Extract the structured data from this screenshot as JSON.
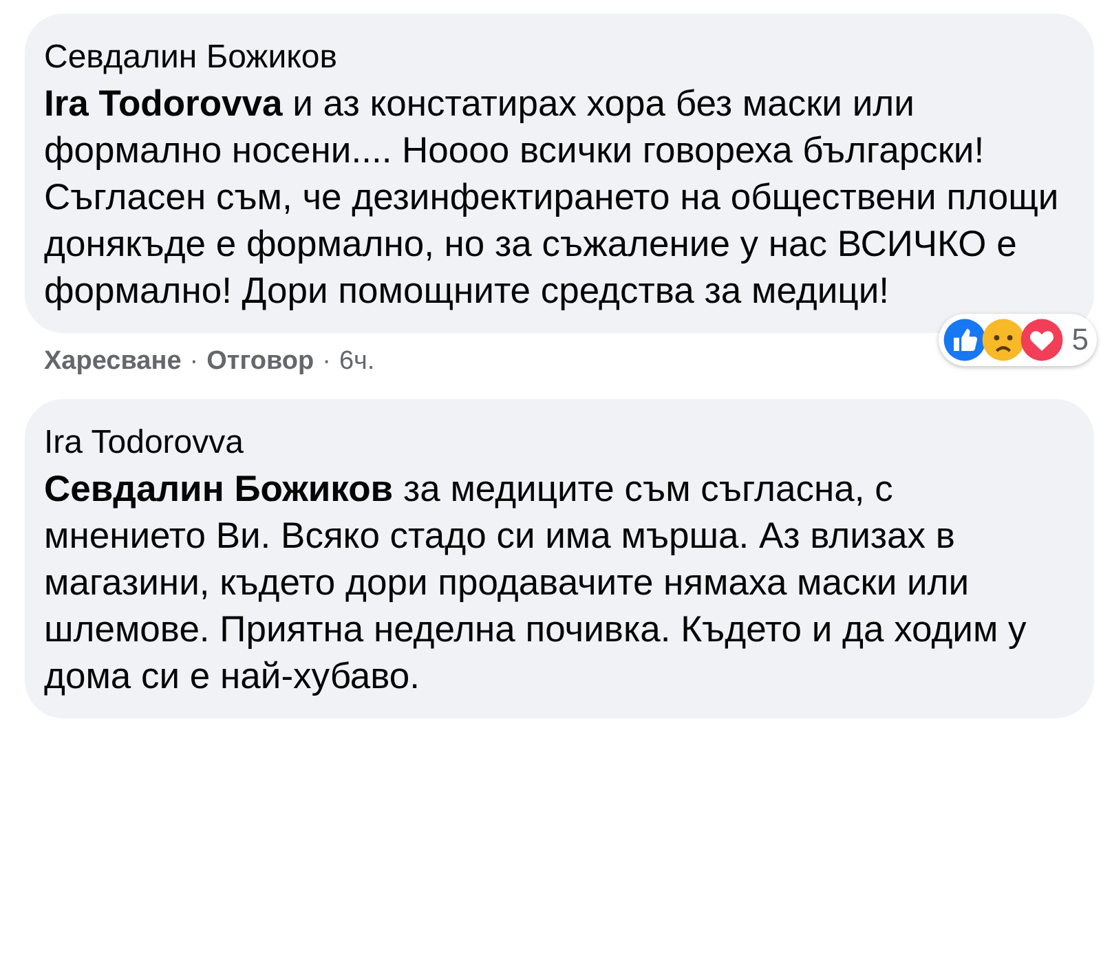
{
  "comments": [
    {
      "author": "Севдалин Божиков",
      "text": "**Ira Todorovva** и аз констатирах хора без маски или формално носени.... Нoooo всички говореха български! Съгласен съм, че дезинфектирането на обществени площи донякъде е формално, но за съжаление у нас ВСИЧКО е формално! Дори помощните средства за медици!",
      "reactions": {
        "icons": [
          {
            "kind": "like"
          },
          {
            "kind": "sad"
          },
          {
            "kind": "love"
          }
        ],
        "count": "5"
      },
      "actions": [
        "Харесване",
        "Отговор"
      ],
      "separator": "·",
      "time": "6ч."
    },
    {
      "author": "Ira Todorovva",
      "text": "**Севдалин Божиков** за медиците съм съгласна, с мнението Ви. Всяко стадо си има мърша. Аз влизах в магазини, където дори продавачите нямаха маски или шлемове. Приятна неделна почивка. Където и да ходим у дома си е най-хубаво."
    }
  ]
}
